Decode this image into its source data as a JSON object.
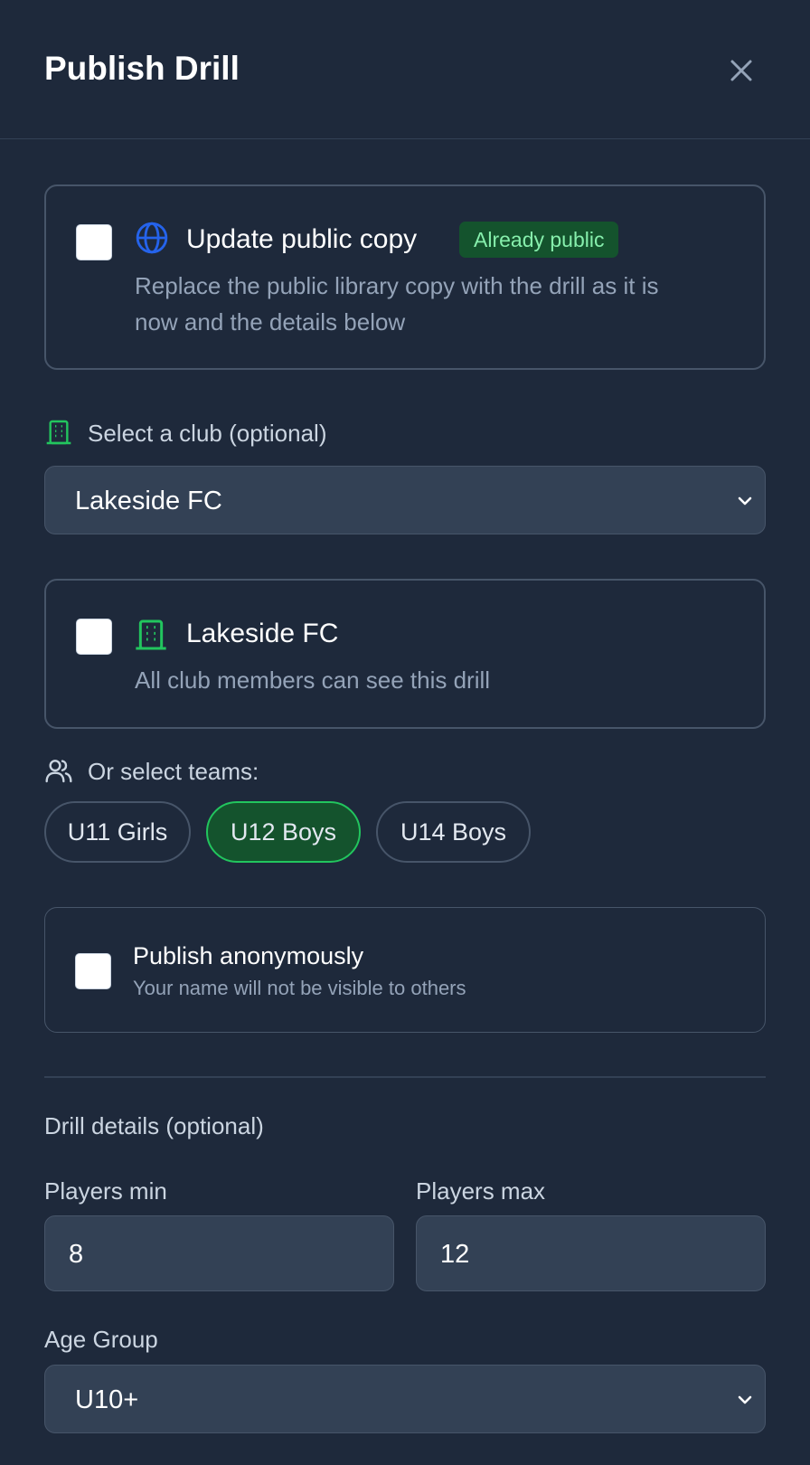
{
  "modal": {
    "title": "Publish Drill"
  },
  "public_copy": {
    "title": "Update public copy",
    "badge": "Already public",
    "description_line1": "Replace the public library copy with the drill as it is",
    "description_line2": "now and the details below",
    "icon": "globe-icon"
  },
  "club_select": {
    "label": "Select a club (optional)",
    "value": "Lakeside FC",
    "icon": "building-icon"
  },
  "club_card": {
    "title": "Lakeside FC",
    "description": "All club members can see this drill",
    "icon": "building-icon"
  },
  "teams": {
    "label": "Or select teams:",
    "icon": "users-icon",
    "items": [
      {
        "label": "U11 Girls",
        "selected": false
      },
      {
        "label": "U12 Boys",
        "selected": true
      },
      {
        "label": "U14 Boys",
        "selected": false
      }
    ]
  },
  "anonymous": {
    "title": "Publish anonymously",
    "description": "Your name will not be visible to others"
  },
  "details": {
    "heading": "Drill details (optional)",
    "players_min_label": "Players min",
    "players_min_value": "8",
    "players_max_label": "Players max",
    "players_max_value": "12",
    "age_group_label": "Age Group",
    "age_group_value": "U10+"
  },
  "colors": {
    "background": "#1e293b",
    "accent_green": "#22c55e",
    "globe_blue": "#2563eb",
    "badge_bg": "#14532d",
    "badge_text": "#86efac"
  }
}
